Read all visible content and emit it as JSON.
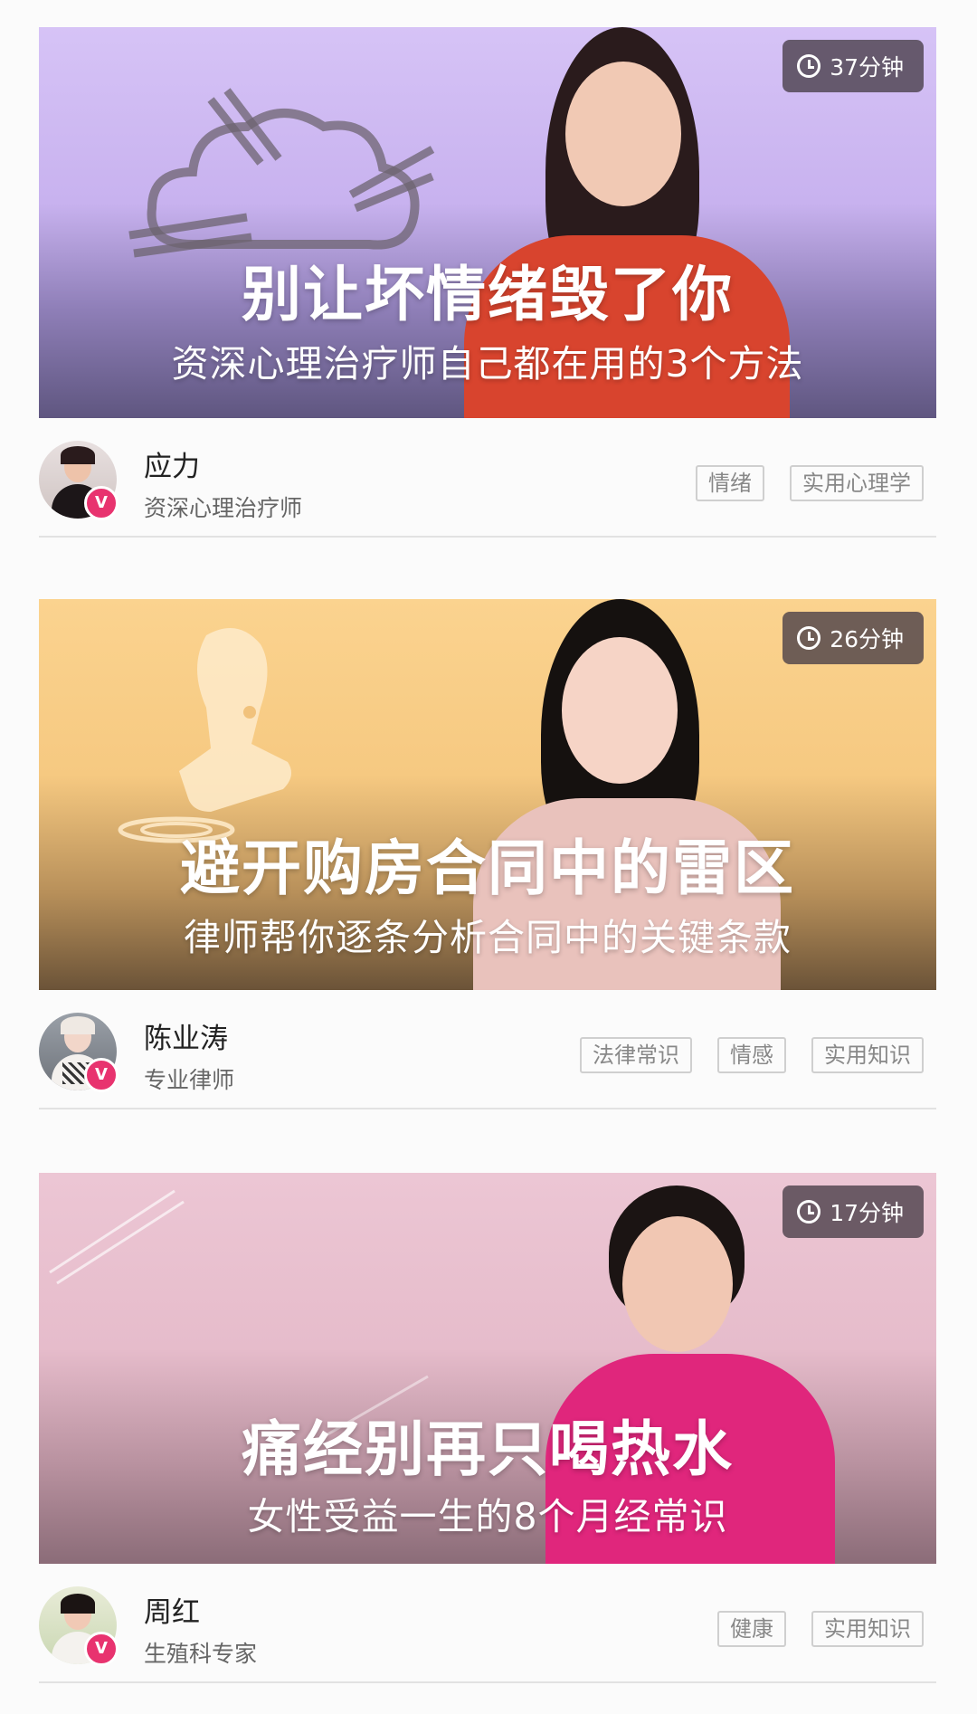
{
  "courses": [
    {
      "duration": "37分钟",
      "title": "别让坏情绪毁了你",
      "subtitle": "资深心理治疗师自己都在用的3个方法",
      "author": "应力",
      "author_title": "资深心理治疗师",
      "tags": [
        "情绪",
        "实用心理学"
      ],
      "colors": {
        "accent": "#cbb6f2",
        "shirt": "#d8442e"
      }
    },
    {
      "duration": "26分钟",
      "title": "避开购房合同中的雷区",
      "subtitle": "律师帮你逐条分析合同中的关键条款",
      "author": "陈业涛",
      "author_title": "专业律师",
      "tags": [
        "法律常识",
        "情感",
        "实用知识"
      ],
      "colors": {
        "accent": "#f8cf8b",
        "shirt": "#e9c2bc"
      }
    },
    {
      "duration": "17分钟",
      "title": "痛经别再只喝热水",
      "subtitle": "女性受益一生的8个月经常识",
      "author": "周红",
      "author_title": "生殖科专家",
      "tags": [
        "健康",
        "实用知识"
      ],
      "colors": {
        "accent": "#e9c1cf",
        "shirt": "#e0267c"
      }
    }
  ],
  "icons": {
    "clock": "clock-icon",
    "verified": "verified-icon",
    "verified_letter": "V"
  }
}
